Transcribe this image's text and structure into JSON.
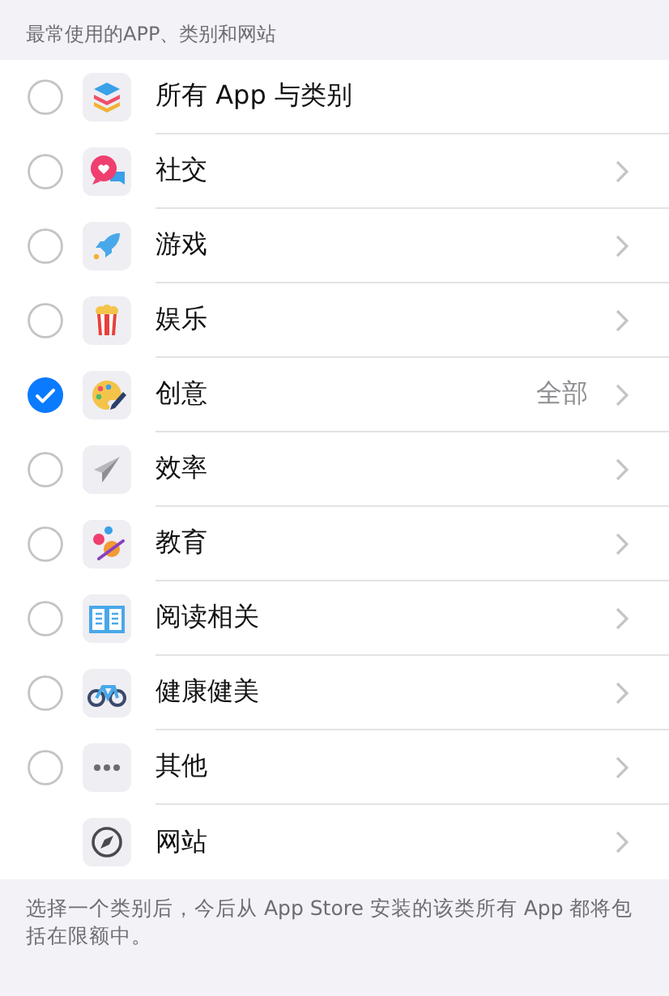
{
  "section_header": "最常使用的APP、类别和网站",
  "items": [
    {
      "kind": "all",
      "label": "所有 App 与类别",
      "checked": false
    },
    {
      "kind": "category",
      "label": "社交",
      "checked": false
    },
    {
      "kind": "category",
      "label": "游戏",
      "checked": false
    },
    {
      "kind": "category",
      "label": "娱乐",
      "checked": false
    },
    {
      "kind": "category",
      "label": "创意",
      "checked": true,
      "detail": "全部"
    },
    {
      "kind": "category",
      "label": "效率",
      "checked": false
    },
    {
      "kind": "category",
      "label": "教育",
      "checked": false
    },
    {
      "kind": "category",
      "label": "阅读相关",
      "checked": false
    },
    {
      "kind": "category",
      "label": "健康健美",
      "checked": false
    },
    {
      "kind": "category",
      "label": "其他",
      "checked": false
    },
    {
      "kind": "website",
      "label": "网站"
    }
  ],
  "footer": "选择一个类别后，今后从 App Store 安装的该类所有 App 都将包括在限额中。"
}
